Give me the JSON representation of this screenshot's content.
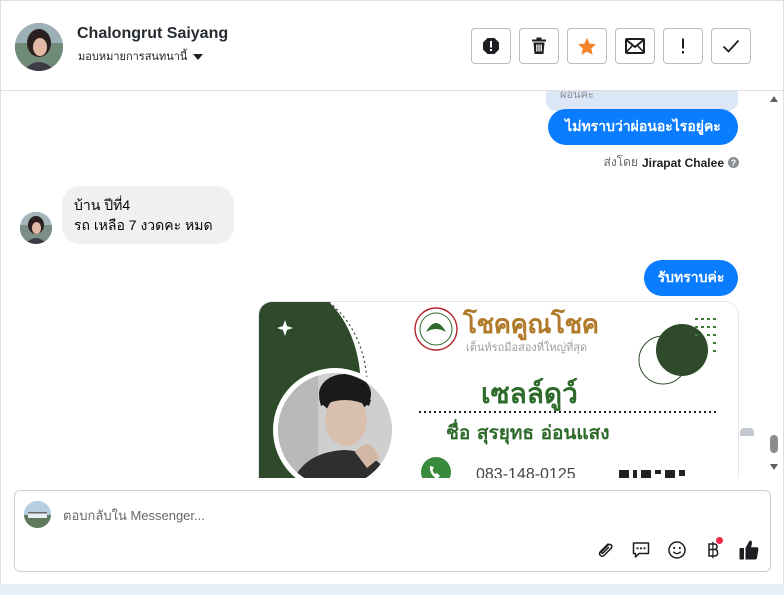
{
  "header": {
    "contact_name": "Chalongrut Saiyang",
    "assignment_label": "มอบหมายการสนทนานี้",
    "buttons": [
      "report",
      "delete",
      "star",
      "mail",
      "mark-important",
      "done"
    ],
    "star_color": "#f5832a"
  },
  "conversation": {
    "quoted_snippet": "ผ่อนคะ",
    "outgoing_1": "ไม่ทราบว่าผ่อนอะไรอยู่คะ",
    "sent_by_prefix": "ส่งโดย",
    "sent_by_name": "Jirapat Chalee",
    "incoming_lines": [
      "บ้าน ปีที่4",
      "รถ เหลือ 7 งวดคะ หมด"
    ],
    "outgoing_2": "รับทราบค่ะ",
    "outgoing_color": "#0a7cff",
    "card": {
      "brand": "โชคคูณโชค",
      "tagline": "เต็นท์รถมือสองที่ใหญ่ที่สุด",
      "role": "เซลล์ดูว์",
      "name_line": "ชื่อ สุรยุทธ อ่อนแสง",
      "phone": "083-148-0125",
      "accent_color": "#2e4a2a"
    }
  },
  "reply": {
    "placeholder": "ตอบกลับใน Messenger...",
    "tools": [
      "attach-icon",
      "saved-reply-icon",
      "emoji-icon",
      "payment-icon",
      "like-icon"
    ]
  }
}
